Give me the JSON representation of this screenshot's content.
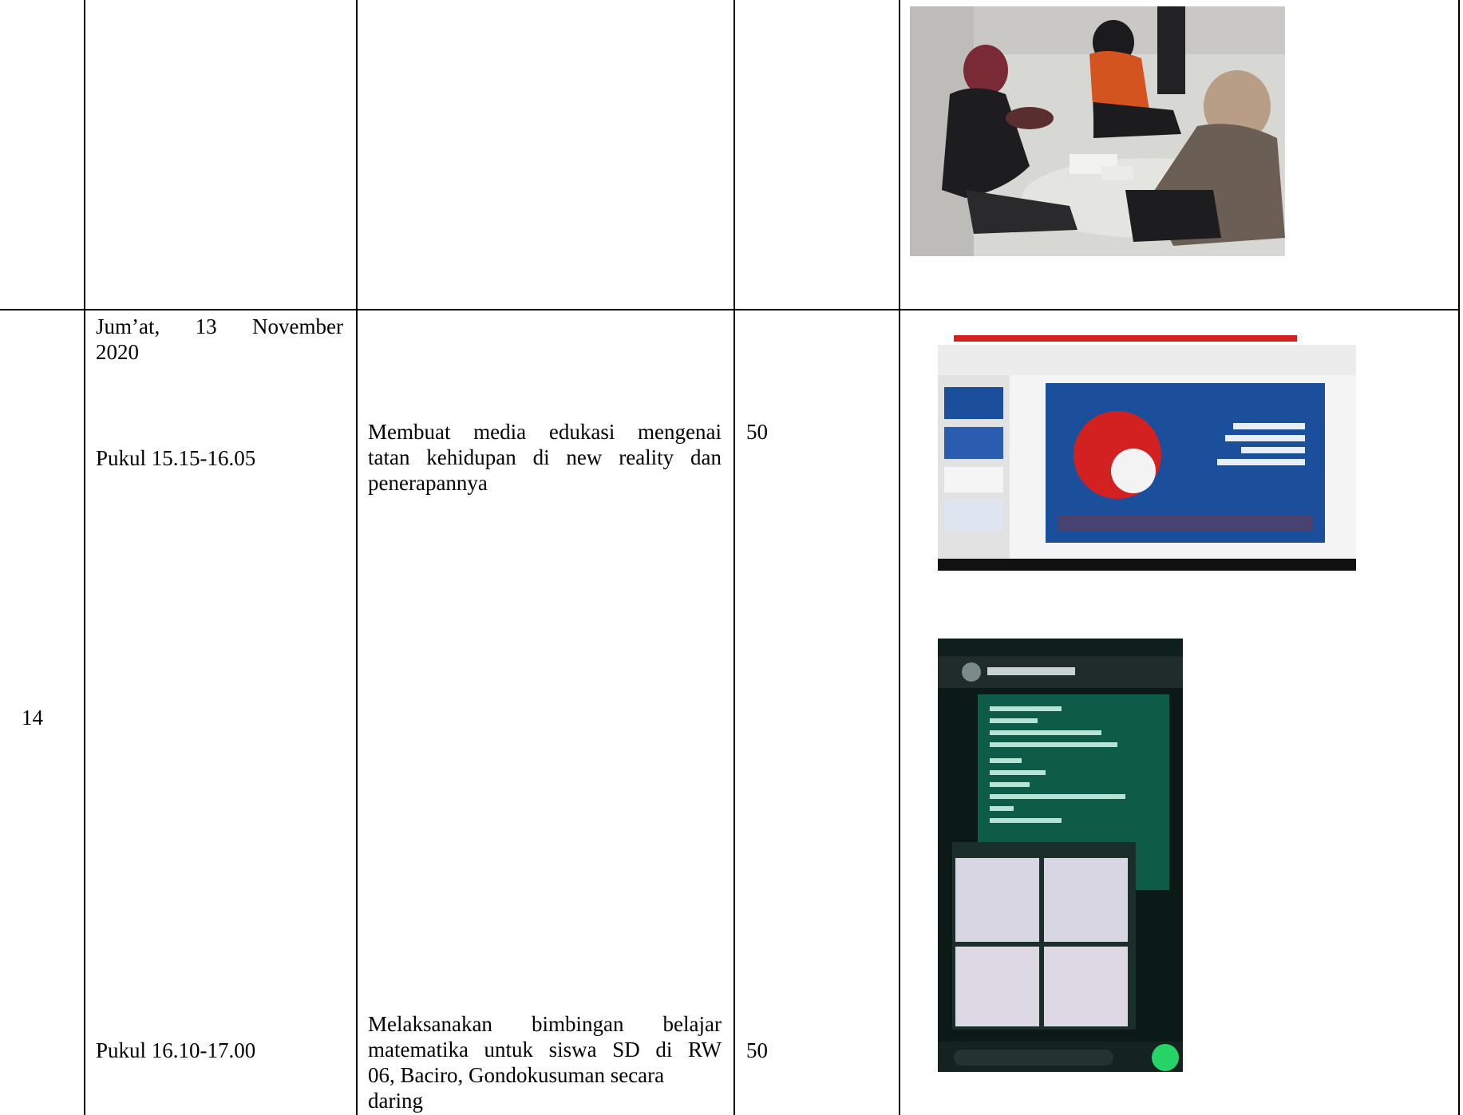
{
  "rows": [
    {
      "number": "",
      "date_lines": [],
      "activities": [],
      "duration": ""
    },
    {
      "number": "14",
      "date_line1_words": [
        "Jum’at,",
        "13",
        "November"
      ],
      "date_line2": "2020",
      "activities": [
        {
          "time": "Pukul 15.15-16.05",
          "desc_lines": [
            "Membuat media edukasi mengenai",
            "tatan kehidupan di new reality dan",
            "penerapannya"
          ],
          "duration": "50"
        },
        {
          "time": "Pukul 16.10-17.00",
          "desc_lines": [
            "Melaksanakan bimbingan belajar",
            "matematika untuk siswa SD di RW",
            "06, Baciro, Gondokusuman secara",
            "daring"
          ],
          "duration": "50"
        }
      ]
    }
  ],
  "images": [
    {
      "name": "photo-students-studying-on-floor"
    },
    {
      "name": "screenshot-presentation-slide"
    },
    {
      "name": "screenshot-whatsapp-chat"
    }
  ],
  "colors": {
    "border": "#000000",
    "slide_blue": "#1b4f9c",
    "slide_red": "#d32020",
    "chat_bg": "#0b1a17",
    "chat_bubble": "#0e5c47",
    "whatsapp_green": "#25d366"
  }
}
